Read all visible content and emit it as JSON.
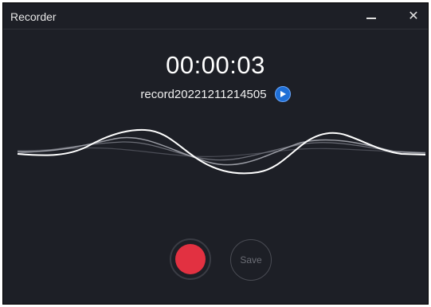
{
  "window": {
    "title": "Recorder",
    "minimize_icon": "minimize-icon",
    "close_label": "✕"
  },
  "recording": {
    "elapsed": "00:00:03",
    "filename": "record20221211214505",
    "play_icon": "play-icon"
  },
  "controls": {
    "record_icon": "record-icon",
    "save_label": "Save"
  },
  "colors": {
    "background": "#1d1f26",
    "record": "#e23141",
    "play_button": "#1f6fd6",
    "text": "#ffffff",
    "save_disabled": "#6b6d75"
  }
}
